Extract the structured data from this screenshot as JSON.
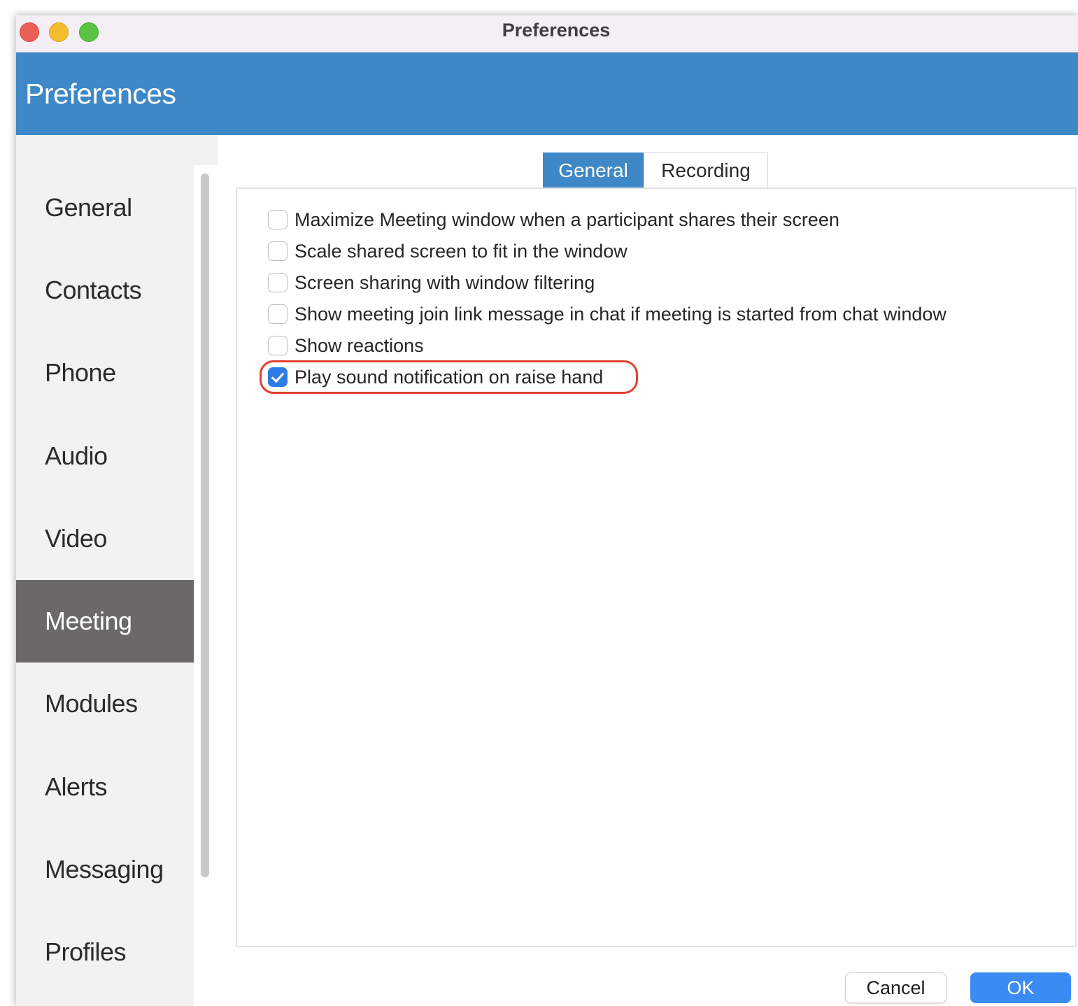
{
  "window": {
    "title": "Preferences"
  },
  "header": {
    "title": "Preferences"
  },
  "sidebar": {
    "items": [
      {
        "label": "General",
        "active": false
      },
      {
        "label": "Contacts",
        "active": false
      },
      {
        "label": "Phone",
        "active": false
      },
      {
        "label": "Audio",
        "active": false
      },
      {
        "label": "Video",
        "active": false
      },
      {
        "label": "Meeting",
        "active": true
      },
      {
        "label": "Modules",
        "active": false
      },
      {
        "label": "Alerts",
        "active": false
      },
      {
        "label": "Messaging",
        "active": false
      },
      {
        "label": "Profiles",
        "active": false
      }
    ]
  },
  "tabs": [
    {
      "label": "General",
      "selected": true
    },
    {
      "label": "Recording",
      "selected": false
    }
  ],
  "options": [
    {
      "label": "Maximize Meeting window when a participant shares their screen",
      "checked": false
    },
    {
      "label": "Scale shared screen to fit in the window",
      "checked": false
    },
    {
      "label": "Screen sharing with window filtering",
      "checked": false
    },
    {
      "label": "Show meeting join link message in chat if meeting is started from chat window",
      "checked": false
    },
    {
      "label": "Show reactions",
      "checked": false
    },
    {
      "label": "Play sound notification on raise hand",
      "checked": true
    }
  ],
  "buttons": {
    "cancel": "Cancel",
    "ok": "OK"
  },
  "colors": {
    "header_blue": "#3e88c7",
    "active_nav": "#6a6868",
    "checkbox_checked": "#2e7be6",
    "highlight_red": "#e2412f",
    "ok_button": "#3a8bf4"
  }
}
